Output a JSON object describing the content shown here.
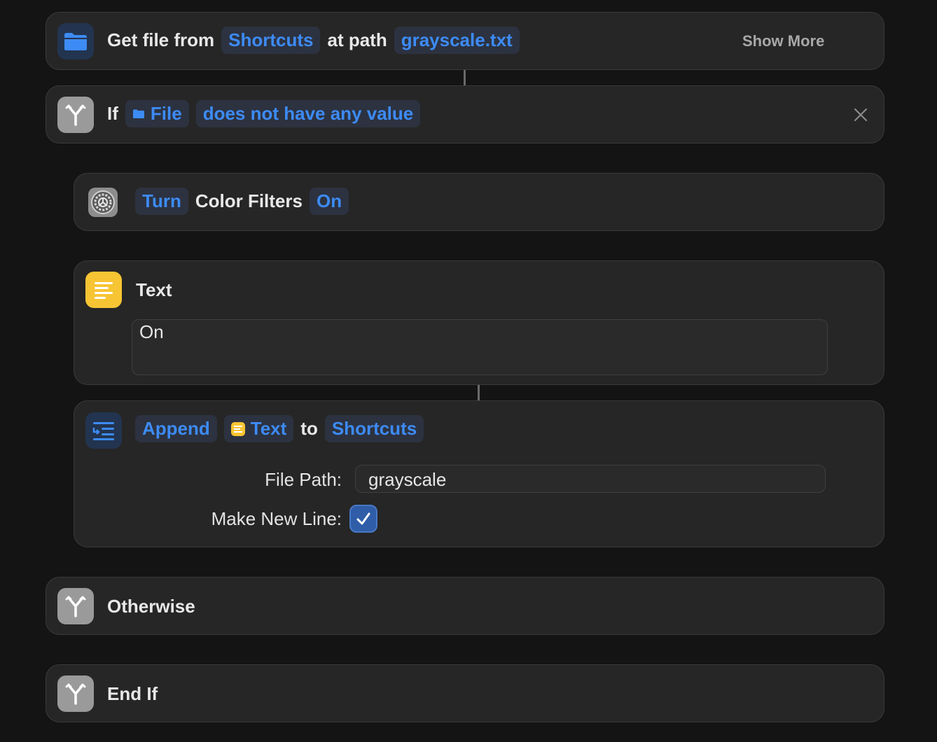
{
  "get_file": {
    "label_prefix": "Get file from",
    "source_token": "Shortcuts",
    "label_middle": "at path",
    "path_token": "grayscale.txt",
    "show_more": "Show More",
    "icon": "folder-icon",
    "accent": "#3d8bf5"
  },
  "if_block": {
    "label": "If",
    "variable_token": "File",
    "condition_token": "does not have any value",
    "icon": "branch-icon"
  },
  "color_filters": {
    "turn_token": "Turn",
    "label": "Color Filters",
    "state_token": "On",
    "icon": "settings-gear-icon"
  },
  "text_action": {
    "title": "Text",
    "content": "On",
    "icon": "text-lines-icon",
    "icon_color": "#f7c533"
  },
  "append_action": {
    "append_token": "Append",
    "text_token": "Text",
    "label_to": "to",
    "dest_token": "Shortcuts",
    "file_path_label": "File Path:",
    "file_path_value": "grayscale",
    "new_line_label": "Make New Line:",
    "new_line_checked": true,
    "icon": "append-text-icon"
  },
  "otherwise": {
    "label": "Otherwise",
    "icon": "branch-icon"
  },
  "end_if": {
    "label": "End If",
    "icon": "branch-icon"
  },
  "colors": {
    "background": "#141414",
    "card": "#262626",
    "token_text": "#3d8bf5",
    "token_bg": "#2c3240",
    "folder_icon_bg": "#1f3150",
    "branch_icon_bg": "#9a9a9a",
    "checkbox": "#2f5da8"
  }
}
